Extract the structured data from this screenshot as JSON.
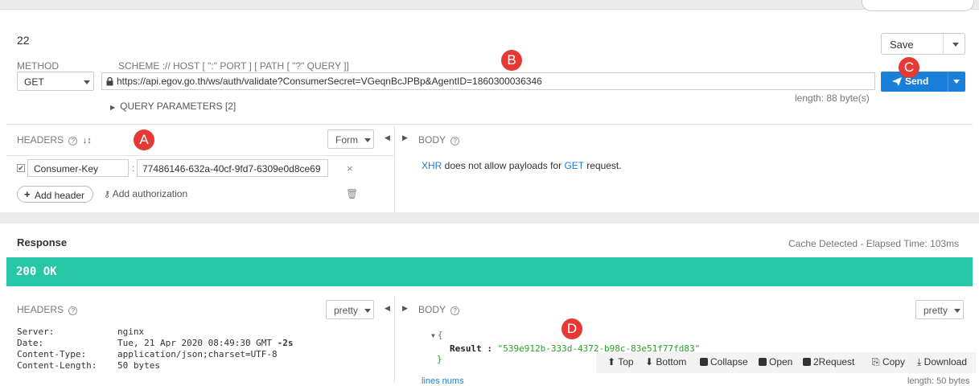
{
  "request": {
    "title": "22",
    "method_label": "METHOD",
    "method_value": "GET",
    "scheme_hint": "SCHEME :// HOST [ \":\" PORT ] [ PATH [ \"?\" QUERY ]]",
    "url": "https://api.egov.go.th/ws/auth/validate?ConsumerSecret=VGeqnBcJPBp&AgentID=1860300036346",
    "length": "length: 88 byte(s)",
    "query_params": "QUERY PARAMETERS [2]",
    "save_label": "Save",
    "send_label": "Send",
    "headers_label": "HEADERS",
    "form_label": "Form",
    "body_label": "BODY",
    "header_key": "Consumer-Key",
    "header_value": "77486146-632a-40cf-9fd7-6309e0d8ce69",
    "add_header": "Add header",
    "add_authorization": "Add authorization",
    "body_msg_prefix": "XHR",
    "body_msg_mid": " does not allow payloads for ",
    "body_msg_get": "GET",
    "body_msg_suffix": " request."
  },
  "markers": {
    "a": "A",
    "b": "B",
    "c": "C",
    "d": "D"
  },
  "response": {
    "title": "Response",
    "elapsed": "Cache Detected - Elapsed Time: 103ms",
    "status": "200 OK",
    "headers_label": "HEADERS",
    "pretty_label": "pretty",
    "body_label": "BODY",
    "headers": [
      {
        "k": "Server:",
        "v": "nginx"
      },
      {
        "k": "Date:",
        "v": "Tue, 21 Apr 2020 08:49:30 GMT",
        "delta": " -2s"
      },
      {
        "k": "Content-Type:",
        "v": "application/json;charset=UTF-8"
      },
      {
        "k": "Content-Length:",
        "v": "50 bytes"
      }
    ],
    "json_open": "{",
    "json_key": "Result :",
    "json_value": "\"539e912b-333d-4372-b98c-83e51f77fd83\"",
    "json_close": "}",
    "lines_label": "lines nums",
    "length_label": "length: 50 bytes",
    "toolbar": {
      "top": "Top",
      "bottom": "Bottom",
      "collapse": "Collapse",
      "open": "Open",
      "to_request": "2Request",
      "copy": "Copy",
      "download": "Download"
    }
  },
  "colors": {
    "accent": "#1a7fd8",
    "status": "#26c6a6",
    "marker": "#e53935"
  }
}
